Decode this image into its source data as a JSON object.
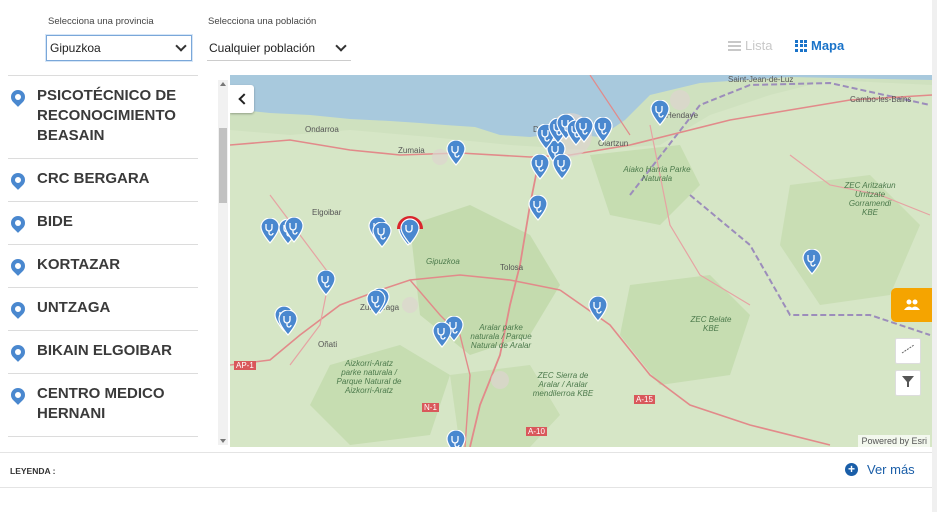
{
  "filters": {
    "provincia_label": "Selecciona una provincia",
    "provincia_value": "Gipuzkoa",
    "poblacion_label": "Selecciona una población",
    "poblacion_value": "Cualquier población"
  },
  "view": {
    "lista_label": "Lista",
    "mapa_label": "Mapa",
    "active": "Mapa"
  },
  "centers": [
    "PSICOTÉCNICO DE RECONOCIMIENTO BEASAIN",
    "CRC BERGARA",
    "BIDE",
    "KORTAZAR",
    "UNTZAGA",
    "BIKAIN ELGOIBAR",
    "CENTRO MEDICO HERNANI"
  ],
  "map": {
    "places": [
      "Saint-Jean-de-Luz",
      "Hendaye",
      "Cambo-les-Bains",
      "Ondarroa",
      "Zumaia",
      "Donostia",
      "Oiartzun",
      "Elgoibar",
      "Tolosa",
      "Gipuzkoa",
      "Oñati",
      "Zumarraga",
      "AP-1",
      "N-1",
      "A-15",
      "A-10"
    ],
    "protected_areas": [
      "Aiako Harria Parke Naturala",
      "ZEC Aritzakun Urritzate Gorramendi KBE",
      "ZEC Belate KBE",
      "Aralar parke naturala / Parque Natural de Aralar",
      "ZEC Sierra de Aralar / Aralar mendilerroa KBE",
      "Aizkorri-Aratz parke naturala / Parque Natural de Aizkorri-Aratz"
    ],
    "attribution": "Powered by Esri",
    "marker_count": 29,
    "selected_marker_color": "#d9262c",
    "marker_color": "#4a88cf",
    "sea_color": "#a8c9dd",
    "land_color": "#cfe1bf"
  },
  "legend": {
    "label": "LEYENDA :",
    "ver_mas": "Ver más"
  }
}
